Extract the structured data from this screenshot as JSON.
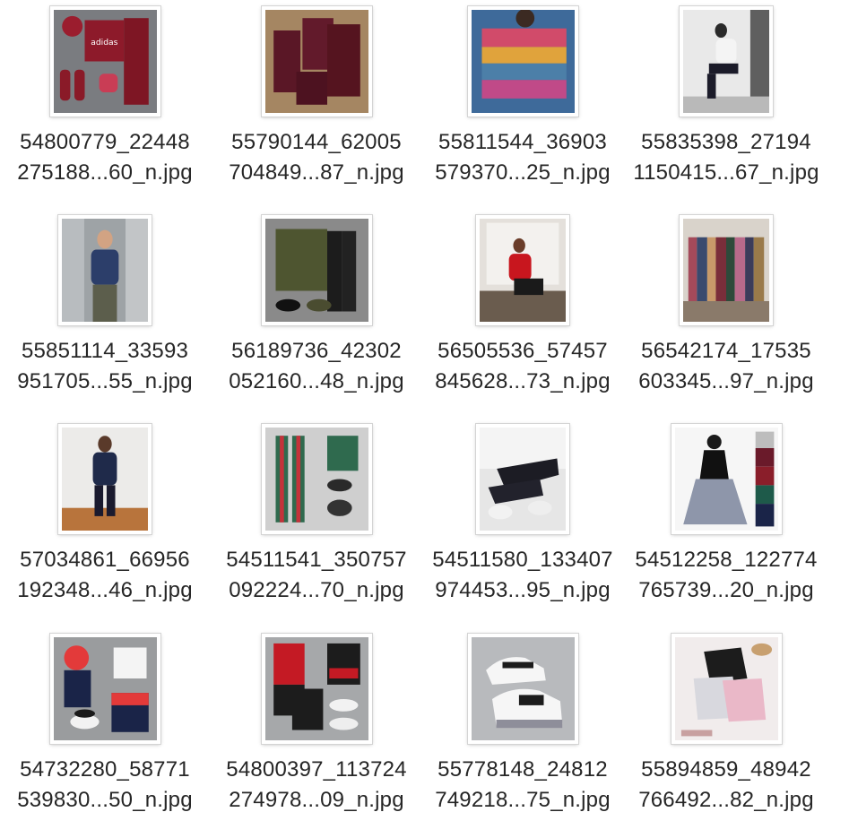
{
  "files": [
    {
      "line1": "54800779_22448",
      "line2": "275188...60_n.jpg",
      "thumb_icon": "image-thumbnail-icon"
    },
    {
      "line1": "55790144_62005",
      "line2": "704849...87_n.jpg",
      "thumb_icon": "image-thumbnail-icon"
    },
    {
      "line1": "55811544_36903",
      "line2": "579370...25_n.jpg",
      "thumb_icon": "image-thumbnail-icon"
    },
    {
      "line1": "55835398_27194",
      "line2": "1150415...67_n.jpg",
      "thumb_icon": "image-thumbnail-icon"
    },
    {
      "line1": "55851114_33593",
      "line2": "951705...55_n.jpg",
      "thumb_icon": "image-thumbnail-icon"
    },
    {
      "line1": "56189736_42302",
      "line2": "052160...48_n.jpg",
      "thumb_icon": "image-thumbnail-icon"
    },
    {
      "line1": "56505536_57457",
      "line2": "845628...73_n.jpg",
      "thumb_icon": "image-thumbnail-icon"
    },
    {
      "line1": "56542174_17535",
      "line2": "603345...97_n.jpg",
      "thumb_icon": "image-thumbnail-icon"
    },
    {
      "line1": "57034861_66956",
      "line2": "192348...46_n.jpg",
      "thumb_icon": "image-thumbnail-icon"
    },
    {
      "line1": "54511541_350757",
      "line2": "092224...70_n.jpg",
      "thumb_icon": "image-thumbnail-icon"
    },
    {
      "line1": "54511580_133407",
      "line2": "974453...95_n.jpg",
      "thumb_icon": "image-thumbnail-icon"
    },
    {
      "line1": "54512258_122774",
      "line2": "765739...20_n.jpg",
      "thumb_icon": "image-thumbnail-icon"
    },
    {
      "line1": "54732280_58771",
      "line2": "539830...50_n.jpg",
      "thumb_icon": "image-thumbnail-icon"
    },
    {
      "line1": "54800397_113724",
      "line2": "274978...09_n.jpg",
      "thumb_icon": "image-thumbnail-icon"
    },
    {
      "line1": "55778148_24812",
      "line2": "749218...75_n.jpg",
      "thumb_icon": "image-thumbnail-icon"
    },
    {
      "line1": "55894859_48942",
      "line2": "766492...82_n.jpg",
      "thumb_icon": "image-thumbnail-icon"
    }
  ]
}
